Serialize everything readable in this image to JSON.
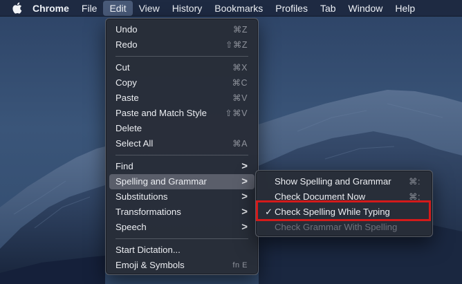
{
  "menubar": {
    "apple_icon": "apple-logo",
    "items": [
      {
        "label": "Chrome"
      },
      {
        "label": "File"
      },
      {
        "label": "Edit"
      },
      {
        "label": "View"
      },
      {
        "label": "History"
      },
      {
        "label": "Bookmarks"
      },
      {
        "label": "Profiles"
      },
      {
        "label": "Tab"
      },
      {
        "label": "Window"
      },
      {
        "label": "Help"
      }
    ],
    "active_item": "Edit"
  },
  "edit_menu": {
    "items": [
      {
        "label": "Undo",
        "shortcut": "⌘Z"
      },
      {
        "label": "Redo",
        "shortcut": "⇧⌘Z"
      },
      {
        "label": "Cut",
        "shortcut": "⌘X"
      },
      {
        "label": "Copy",
        "shortcut": "⌘C"
      },
      {
        "label": "Paste",
        "shortcut": "⌘V"
      },
      {
        "label": "Paste and Match Style",
        "shortcut": "⇧⌘V"
      },
      {
        "label": "Delete",
        "shortcut": ""
      },
      {
        "label": "Select All",
        "shortcut": "⌘A"
      },
      {
        "label": "Find",
        "shortcut": ">"
      },
      {
        "label": "Spelling and Grammar",
        "shortcut": ">"
      },
      {
        "label": "Substitutions",
        "shortcut": ">"
      },
      {
        "label": "Transformations",
        "shortcut": ">"
      },
      {
        "label": "Speech",
        "shortcut": ">"
      },
      {
        "label": "Start Dictation...",
        "shortcut": ""
      },
      {
        "label": "Emoji & Symbols",
        "shortcut": "fn E"
      }
    ],
    "highlighted": "Spelling and Grammar"
  },
  "spelling_submenu": {
    "items": [
      {
        "label": "Show Spelling and Grammar",
        "shortcut": "⌘:",
        "checked": false,
        "enabled": true
      },
      {
        "label": "Check Document Now",
        "shortcut": "⌘;",
        "checked": false,
        "enabled": true
      },
      {
        "label": "Check Spelling While Typing",
        "shortcut": "",
        "checked": true,
        "check_mark": "✓",
        "enabled": true
      },
      {
        "label": "Check Grammar With Spelling",
        "shortcut": "",
        "checked": false,
        "enabled": false
      }
    ]
  },
  "colors": {
    "menubar_bg": "#1c263c",
    "menu_bg": "#282d38",
    "highlight": "#5f6470",
    "annotation_red": "#d41a1a"
  }
}
